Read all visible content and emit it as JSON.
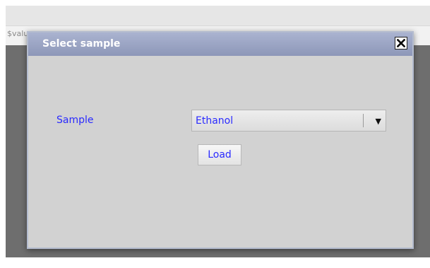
{
  "background": {
    "field_text": "$value"
  },
  "dialog": {
    "title": "Select sample",
    "close_icon": "close-icon",
    "sample_label": "Sample",
    "sample_select": {
      "selected": "Ethanol",
      "arrow": "▼"
    },
    "load_label": "Load"
  },
  "colors": {
    "title_bar": "#9aa3c3",
    "label_text": "#2a2aff",
    "overlay": "#6e6e6e",
    "dialog_bg": "#d2d2d2"
  }
}
